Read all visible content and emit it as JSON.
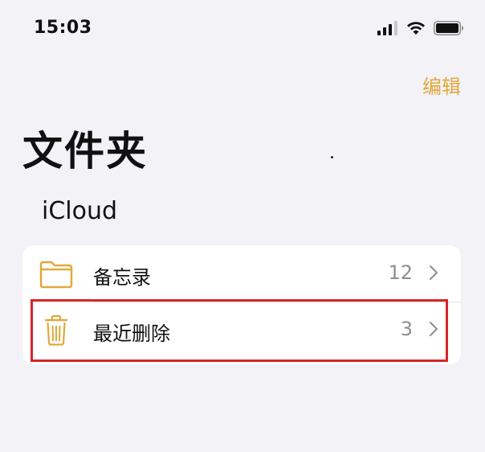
{
  "status_bar": {
    "time": "15:03",
    "icons": [
      "signal-icon",
      "wifi-icon",
      "battery-icon"
    ]
  },
  "nav": {
    "edit_label": "编辑"
  },
  "page": {
    "title": "文件夹"
  },
  "section": {
    "header": "iCloud",
    "folders": [
      {
        "label": "备忘录",
        "count": "12",
        "icon": "folder-icon"
      },
      {
        "label": "最近删除",
        "count": "3",
        "icon": "trash-icon"
      }
    ]
  },
  "colors": {
    "accent": "#e0a93a",
    "background": "#f2f2f7",
    "highlight": "#d9242a",
    "secondary_text": "#8e8e93"
  }
}
